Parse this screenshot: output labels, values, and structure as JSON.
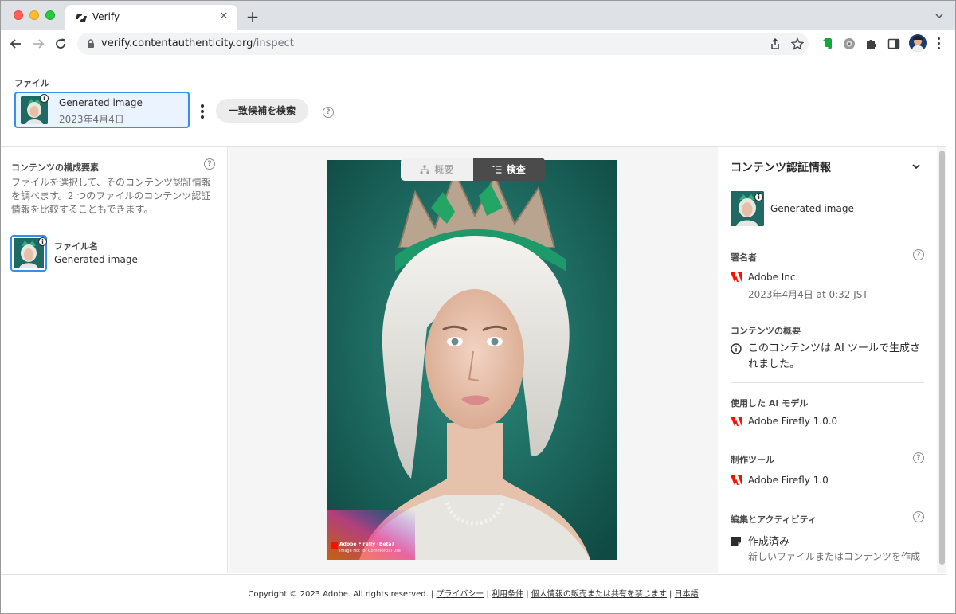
{
  "browser": {
    "tab_title": "Verify",
    "url_host": "verify.contentauthenticity.org",
    "url_path": "/inspect"
  },
  "files": {
    "label": "ファイル",
    "file_name": "Generated image",
    "file_date": "2023年4月4日",
    "search_match_label": "一致候補を検索"
  },
  "left_panel": {
    "title": "コンテンツの構成要素",
    "description": "ファイルを選択して、そのコンテンツ認証情報を調べます。2 つのファイルのコンテンツ認証情報を比較することもできます。",
    "item_label": "ファイル名",
    "item_name": "Generated image"
  },
  "center": {
    "overview_label": "概要",
    "inspect_label": "検査",
    "watermark_title": "Adobe Firefly (Beta)",
    "watermark_sub": "Image Not for Commercial Use"
  },
  "right_panel": {
    "title": "コンテンツ認証情報",
    "thumb_name": "Generated image",
    "signer_label": "署名者",
    "signer_name": "Adobe Inc.",
    "signer_date": "2023年4月4日 at 0:32 JST",
    "summary_label": "コンテンツの概要",
    "summary_text": "このコンテンツは AI ツールで生成されました。",
    "ai_model_label": "使用した AI モデル",
    "ai_model_name": "Adobe Firefly 1.0.0",
    "tool_label": "制作ツール",
    "tool_name": "Adobe Firefly 1.0",
    "activity_label": "編集とアクティビティ",
    "activity_title": "作成済み",
    "activity_desc": "新しいファイルまたはコンテンツを作成"
  },
  "footer": {
    "copyright": "Copyright © 2023 Adobe. All rights reserved.",
    "privacy": "プライバシー",
    "terms": "利用条件",
    "do_not_sell": "個人情報の販売または共有を禁じます",
    "language": "日本語"
  },
  "colors": {
    "accent_blue": "#378ef0",
    "adobe_red": "#fa0f00",
    "toggle_active": "#4b4b4b"
  },
  "icons": [
    "verify-favicon-icon",
    "close-icon",
    "plus-icon",
    "back-arrow-icon",
    "forward-arrow-icon",
    "reload-icon",
    "lock-icon",
    "share-icon",
    "star-icon",
    "evernote-icon",
    "extension-gear-icon",
    "puzzle-icon",
    "sidebar-icon",
    "avatar",
    "chevron-down-icon",
    "help-icon",
    "more-vertical-icon",
    "hierarchy-icon",
    "list-icon",
    "info-icon",
    "adobe-logo-icon",
    "activity-icon"
  ]
}
